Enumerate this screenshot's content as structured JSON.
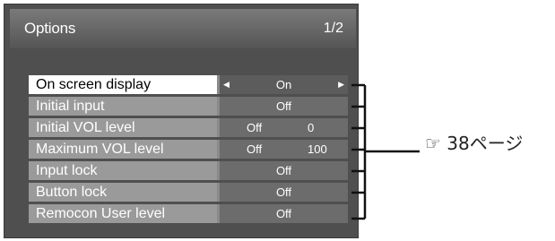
{
  "window": {
    "title": "Options",
    "page": "1/2"
  },
  "rows": [
    {
      "label": "On screen display",
      "value": "On",
      "selected": true
    },
    {
      "label": "Initial input",
      "value": "Off"
    },
    {
      "label": "Initial VOL level",
      "value1": "Off",
      "value2": "0"
    },
    {
      "label": "Maximum VOL level",
      "value1": "Off",
      "value2": "100"
    },
    {
      "label": "Input lock",
      "value": "Off"
    },
    {
      "label": "Button lock",
      "value": "Off"
    },
    {
      "label": "Remocon User level",
      "value": "Off"
    }
  ],
  "reference": {
    "icon": "pointing-hand-icon",
    "text": "☞ 38ページ"
  },
  "colors": {
    "panel": "#4f4f4f",
    "selected_label_bg": "#ffffff",
    "label_bg": "#9a9a9a",
    "value_bg": "#6c6c6c"
  }
}
